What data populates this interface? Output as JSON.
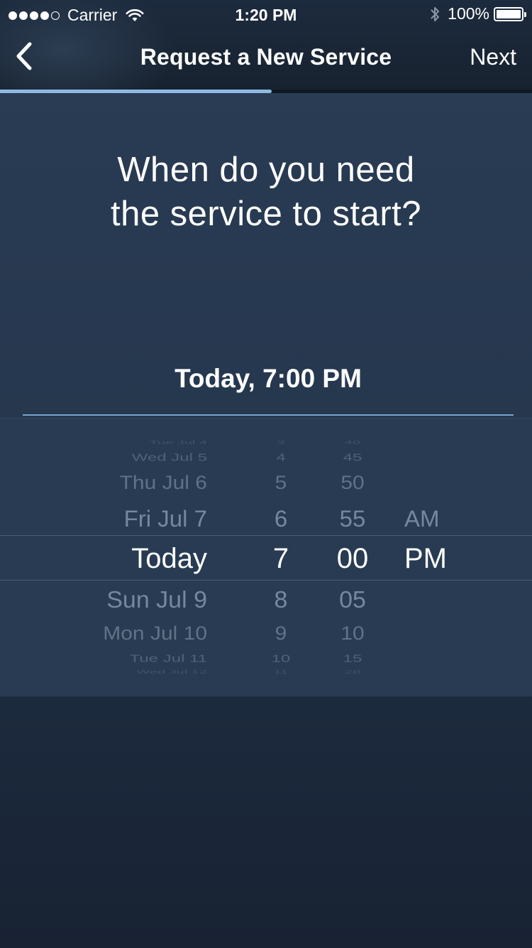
{
  "status_bar": {
    "signal_filled": 4,
    "signal_total": 5,
    "carrier": "Carrier",
    "time": "1:20 PM",
    "battery": "100%"
  },
  "nav": {
    "back_icon": "chevron-left-icon",
    "title": "Request a New Service",
    "next_label": "Next"
  },
  "progress": {
    "fraction": 0.51
  },
  "question": {
    "line1": "When do you need",
    "line2": "the service to start?"
  },
  "selected_datetime": "Today, 7:00 PM",
  "picker": {
    "date": [
      "Tue Jul 4",
      "Wed Jul 5",
      "Thu Jul 6",
      "Fri Jul 7",
      "Today",
      "Sun Jul 9",
      "Mon Jul 10",
      "Tue Jul 11",
      "Wed Jul 12"
    ],
    "hour": [
      "3",
      "4",
      "5",
      "6",
      "7",
      "8",
      "9",
      "10",
      "11"
    ],
    "minute": [
      "40",
      "45",
      "50",
      "55",
      "00",
      "05",
      "10",
      "15",
      "20"
    ],
    "ampm": [
      "",
      "",
      "",
      "AM",
      "PM",
      "",
      "",
      "",
      ""
    ],
    "selected_index": 4
  },
  "colors": {
    "accent": "#8fb9e3",
    "background": "#26374e",
    "picker_background": "#283b52"
  }
}
